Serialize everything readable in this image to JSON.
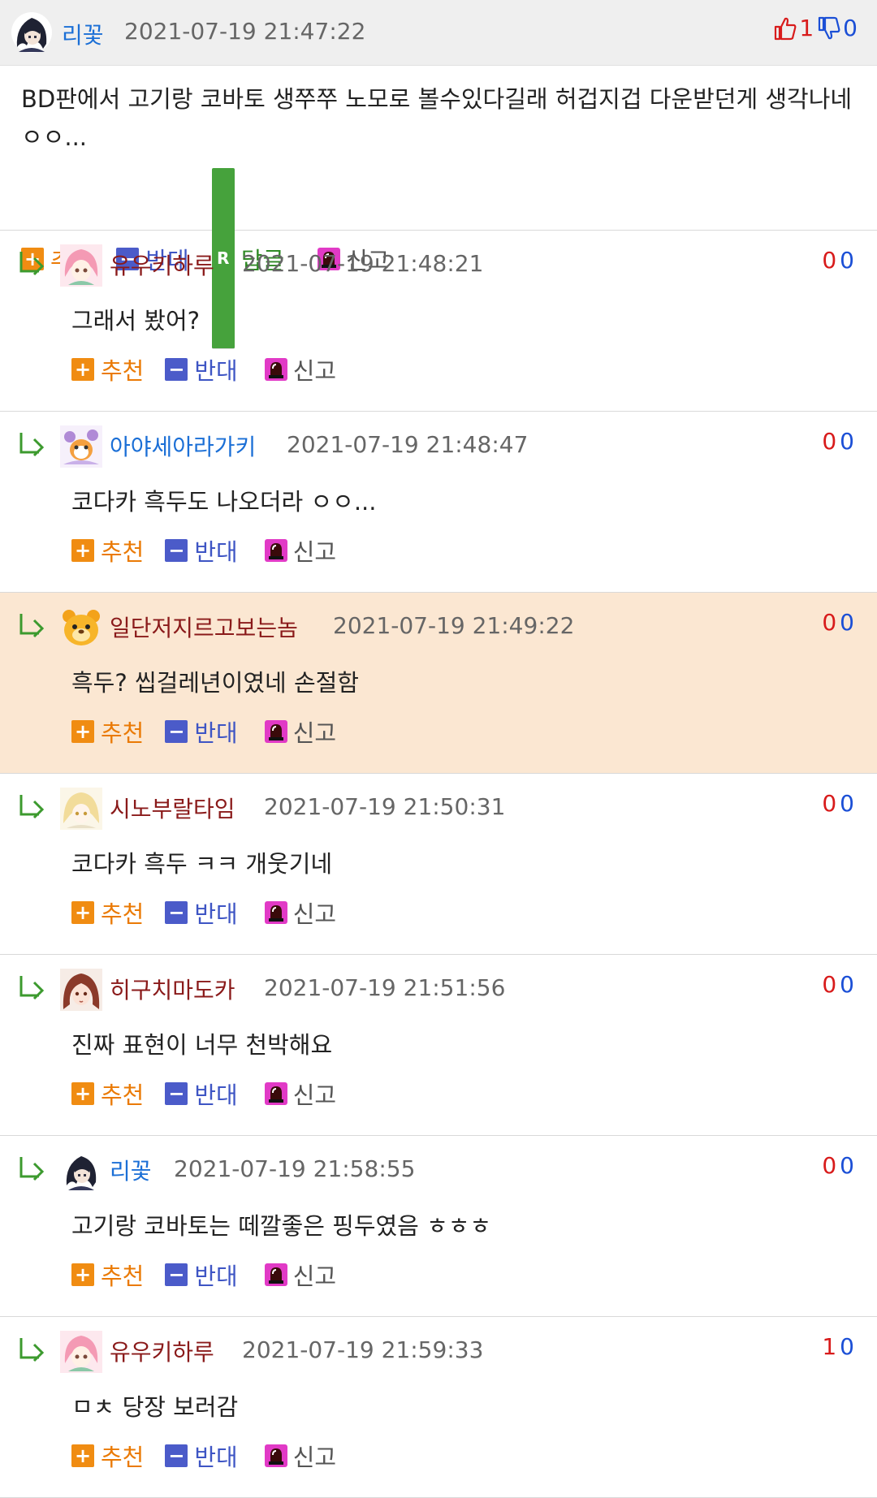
{
  "main_comment": {
    "nick": "리꽃",
    "date": "2021-07-19 21:47:22",
    "up": "1",
    "down": "0",
    "text": "BD판에서 고기랑 코바토 생쭈쭈 노모로 볼수있다길래 허겁지겁 다운받던게 생각나네 ㅇㅇ...",
    "actions": {
      "recommend": "추천",
      "oppose": "반대",
      "reply": "답글",
      "report": "신고"
    },
    "reply_box_letter": "R"
  },
  "replies": [
    {
      "nick": "유우키하루",
      "date": "2021-07-19 21:48:21",
      "up": "0",
      "down": "0",
      "text": "그래서 봤어?"
    },
    {
      "nick": "아야세아라가키",
      "date": "2021-07-19 21:48:47",
      "up": "0",
      "down": "0",
      "text": "코다카 흑두도 나오더라 ㅇㅇ..."
    },
    {
      "nick": "일단저지르고보는놈",
      "date": "2021-07-19 21:49:22",
      "up": "0",
      "down": "0",
      "text": "흑두? 씹걸레년이였네 손절함"
    },
    {
      "nick": "시노부랄타임",
      "date": "2021-07-19 21:50:31",
      "up": "0",
      "down": "0",
      "text": "코다카 흑두 ㅋㅋ 개웃기네"
    },
    {
      "nick": "히구치마도카",
      "date": "2021-07-19 21:51:56",
      "up": "0",
      "down": "0",
      "text": "진짜 표현이 너무 천박해요"
    },
    {
      "nick": "리꽃",
      "date": "2021-07-19 21:58:55",
      "up": "0",
      "down": "0",
      "text": "고기랑 코바토는 떼깔좋은 핑두였음 ㅎㅎㅎ"
    },
    {
      "nick": "유우키하루",
      "date": "2021-07-19 21:59:33",
      "up": "1",
      "down": "0",
      "text": "ㅁㅊ 당장 보러감"
    }
  ],
  "reply_actions": {
    "recommend": "추천",
    "oppose": "반대",
    "report": "신고"
  },
  "colors": {
    "highlight_bg": "#fbe7d2",
    "recommend": "#ea7a05",
    "oppose": "#3e55c4",
    "up": "#d81b1b",
    "down": "#1b4fd6"
  }
}
